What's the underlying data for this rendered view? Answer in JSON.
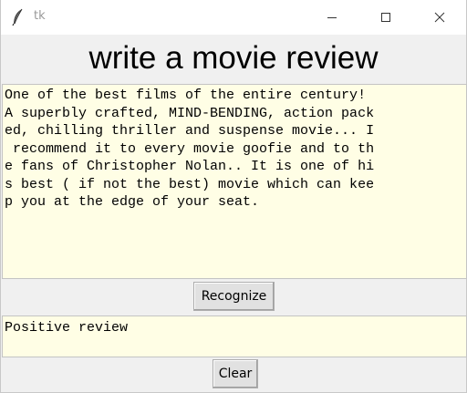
{
  "window": {
    "title": "tk",
    "icon": "feather-icon",
    "controls": [
      "minimize-icon",
      "maximize-icon",
      "close-icon"
    ]
  },
  "heading": "write a movie review",
  "review": {
    "text": "One of the best films of the entire century!\nA superbly crafted, MIND-BENDING, action pack\ned, chilling thriller and suspense movie... I\n recommend it to every movie goofie and to th\ne fans of Christopher Nolan.. It is one of hi\ns best ( if not the best) movie which can kee\np you at the edge of your seat."
  },
  "buttons": {
    "recognize_label": "Recognize",
    "clear_label": "Clear"
  },
  "result": {
    "text": "Positive review"
  },
  "colors": {
    "text_bg": "#fffee5",
    "window_bg": "#f0f0f0",
    "button_bg": "#e1e1e1"
  }
}
